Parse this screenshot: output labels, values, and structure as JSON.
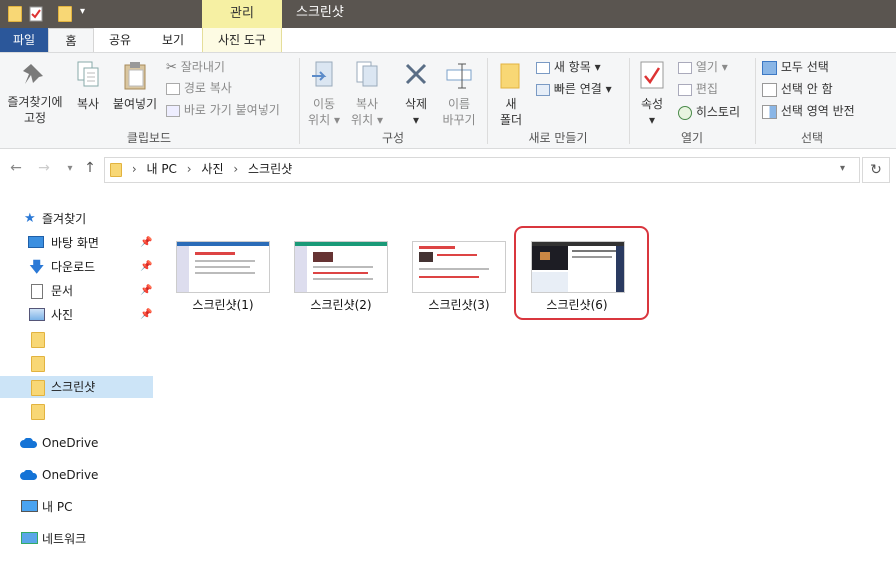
{
  "window": {
    "title": "스크린샷",
    "context_tab": "관리"
  },
  "ribbon_tabs": {
    "file": "파일",
    "home": "홈",
    "share": "공유",
    "view": "보기",
    "photo_tools": "사진 도구"
  },
  "clipboard": {
    "pin_line1": "즐겨찾기에",
    "pin_line2": "고정",
    "copy": "복사",
    "paste": "붙여넣기",
    "cut": "잘라내기",
    "copy_path": "경로 복사",
    "paste_shortcut": "바로 가기 붙여넣기",
    "label": "클립보드"
  },
  "organize": {
    "move_line1": "이동",
    "move_line2": "위치",
    "copyto_line1": "복사",
    "copyto_line2": "위치",
    "delete": "삭제",
    "rename_line1": "이름",
    "rename_line2": "바꾸기",
    "label": "구성"
  },
  "new": {
    "new_folder_line1": "새",
    "new_folder_line2": "폴더",
    "new_item": "새 항목",
    "easy_access": "빠른 연결",
    "label": "새로 만들기"
  },
  "open": {
    "properties": "속성",
    "open": "열기",
    "edit": "편집",
    "history": "히스토리",
    "label": "열기"
  },
  "select": {
    "select_all": "모두 선택",
    "select_none": "선택 안 함",
    "invert": "선택 영역 반전",
    "label": "선택"
  },
  "address": {
    "crumbs": [
      "내 PC",
      "사진",
      "스크린샷"
    ]
  },
  "sidebar": {
    "quick_access": "즐겨찾기",
    "desktop": "바탕 화면",
    "downloads": "다운로드",
    "documents": "문서",
    "pictures": "사진",
    "selected": "스크린샷",
    "onedrive1": "OneDrive",
    "onedrive2": "OneDrive",
    "this_pc": "내 PC",
    "network": "네트워크"
  },
  "files": [
    {
      "name": "스크린샷(1)"
    },
    {
      "name": "스크린샷(2)"
    },
    {
      "name": "스크린샷(3)"
    },
    {
      "name": "스크린샷(6)"
    }
  ],
  "colors": {
    "accent": "#2b579a",
    "manage_tab": "#f6f0a3",
    "highlight": "#d9363e",
    "selection": "#cce4f7"
  }
}
